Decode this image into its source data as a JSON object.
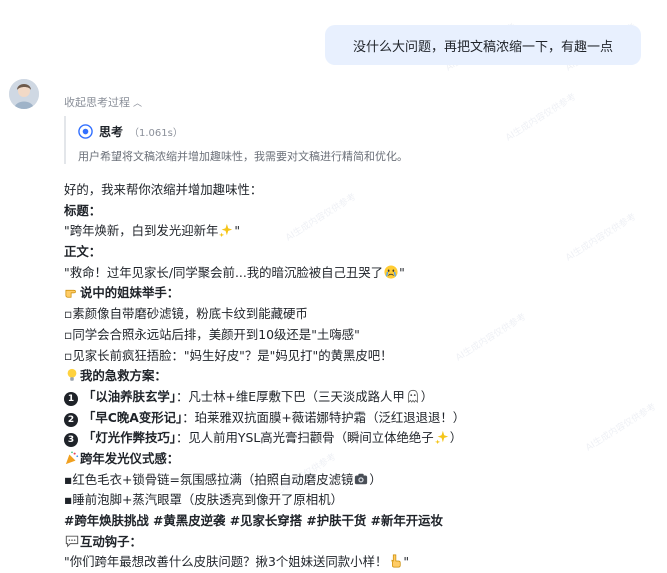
{
  "user_message": "没什么大问题，再把文稿浓缩一下，有趣一点",
  "thinking": {
    "collapse_label": "收起思考过程",
    "title": "思考",
    "time": "（1.061s）",
    "text": "用户希望将文稿浓缩并增加趣味性，我需要对文稿进行精简和优化。"
  },
  "answer": {
    "intro": "好的，我来帮你浓缩并增加趣味性：",
    "title_label": "标题：",
    "title_text": "\"跨年焕新，白到发光迎新年",
    "title_end": "\"",
    "body_label": "正文：",
    "body_text": "\"救命！过年见家长/同学聚会前...我的暗沉脸被自己丑哭了",
    "body_end": "\"",
    "sisters_label": "说中的姐妹举手：",
    "sisters": [
      "▫素颜像自带磨砂滤镜，粉底卡纹到能藏硬币",
      "▫同学会合照永远站后排，美颜开到10级还是\"土嗨感\"",
      "▫见家长前疯狂捂脸：\"妈生好皮\"？是\"妈见打\"的黄黑皮吧！"
    ],
    "rescue_label": "我的急救方案：",
    "rescue": [
      {
        "num": "1",
        "title": "「以油养肤玄学」",
        "desc": "：凡士林+维E厚敷下巴（三天淡成路人甲",
        "end": "）"
      },
      {
        "num": "2",
        "title": "「早C晚A变形记」",
        "desc": "：珀莱雅双抗面膜+薇诺娜特护霜（泛红退退退！）",
        "end": ""
      },
      {
        "num": "3",
        "title": "「灯光作弊技巧」",
        "desc": "：见人前用YSL高光膏扫颧骨（瞬间立体绝绝子",
        "end": "）"
      }
    ],
    "ritual_label": "跨年发光仪式感：",
    "rituals": [
      {
        "text": "▪红色毛衣+锁骨链=氛围感拉满（拍照自动磨皮滤镜",
        "end": "）"
      },
      {
        "text": "▪睡前泡脚+蒸汽眼罩（皮肤透亮到像开了原相机）",
        "end": ""
      }
    ],
    "hashtags": "#跨年焕肤挑战 #黄黑皮逆袭 #见家长穿搭 #护肤干货 #新年开运妆",
    "hook_label": "互动钩子：",
    "hook_text": "\"你们跨年最想改善什么皮肤问题？揪3个姐妹送同款小样！",
    "hook_end": "\""
  },
  "watermark": "AI生成内容仅供参考"
}
